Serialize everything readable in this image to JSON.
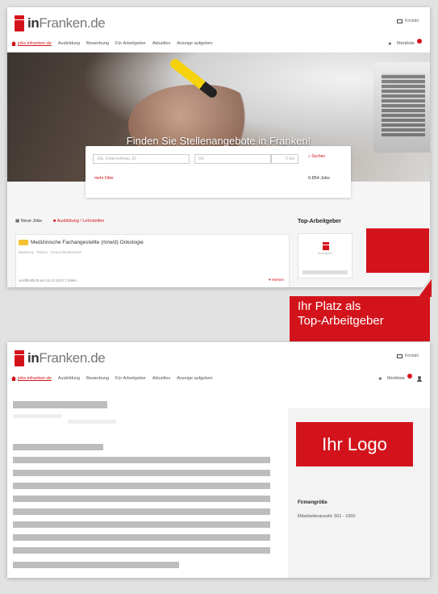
{
  "brand": {
    "accent": "#d3131b",
    "placeholder_gray": "#bdbdbd"
  },
  "logo": {
    "prefix": "in",
    "main": "Franken",
    "suffix": ".de"
  },
  "util": {
    "label": "Kontakt",
    "icon": "grid-icon"
  },
  "nav": {
    "items": [
      "jobs.infranken.de",
      "Ausbildung",
      "Bewerbung",
      "Für Arbeitgeber",
      "Aktuelles",
      "Anzeige aufgeben"
    ],
    "merkliste": "Merkliste",
    "home_icon": "home-icon",
    "star_icon": "star-icon",
    "user_icon": "user-icon"
  },
  "hero": {
    "title": "Finden Sie Stellenangebote in Franken!"
  },
  "search": {
    "what_placeholder": "Job, Unternehmen, ID",
    "where_placeholder": "Ort",
    "radius": "0 km",
    "button": "Suchen",
    "more_filters": "mehr Filter",
    "count": "6.854 Jobs"
  },
  "results": {
    "tab_new": "Neue Jobs",
    "tab_training": "Ausbildung / Lehrstellen",
    "job": {
      "title": "Medizinische Fachangestellte (m/w/d) Onkologie",
      "subtitle": "Bamberg · Teilzeit · Gesundheitswesen",
      "meta": "veröffentlicht am 02.12.2017 | Teilen",
      "save": "Merken"
    }
  },
  "top_employers": {
    "title": "Top-Arbeitgeber",
    "card_text": "Arbeitgeber"
  },
  "callout": {
    "line1": "Ihr Platz als",
    "line2": "Top-Arbeitgeber"
  },
  "profile": {
    "logo_label": "Ihr Logo",
    "firm_size_label": "Firmengröße",
    "firm_size_value": "Mitarbeiteranzahl: 501 - 1000"
  }
}
